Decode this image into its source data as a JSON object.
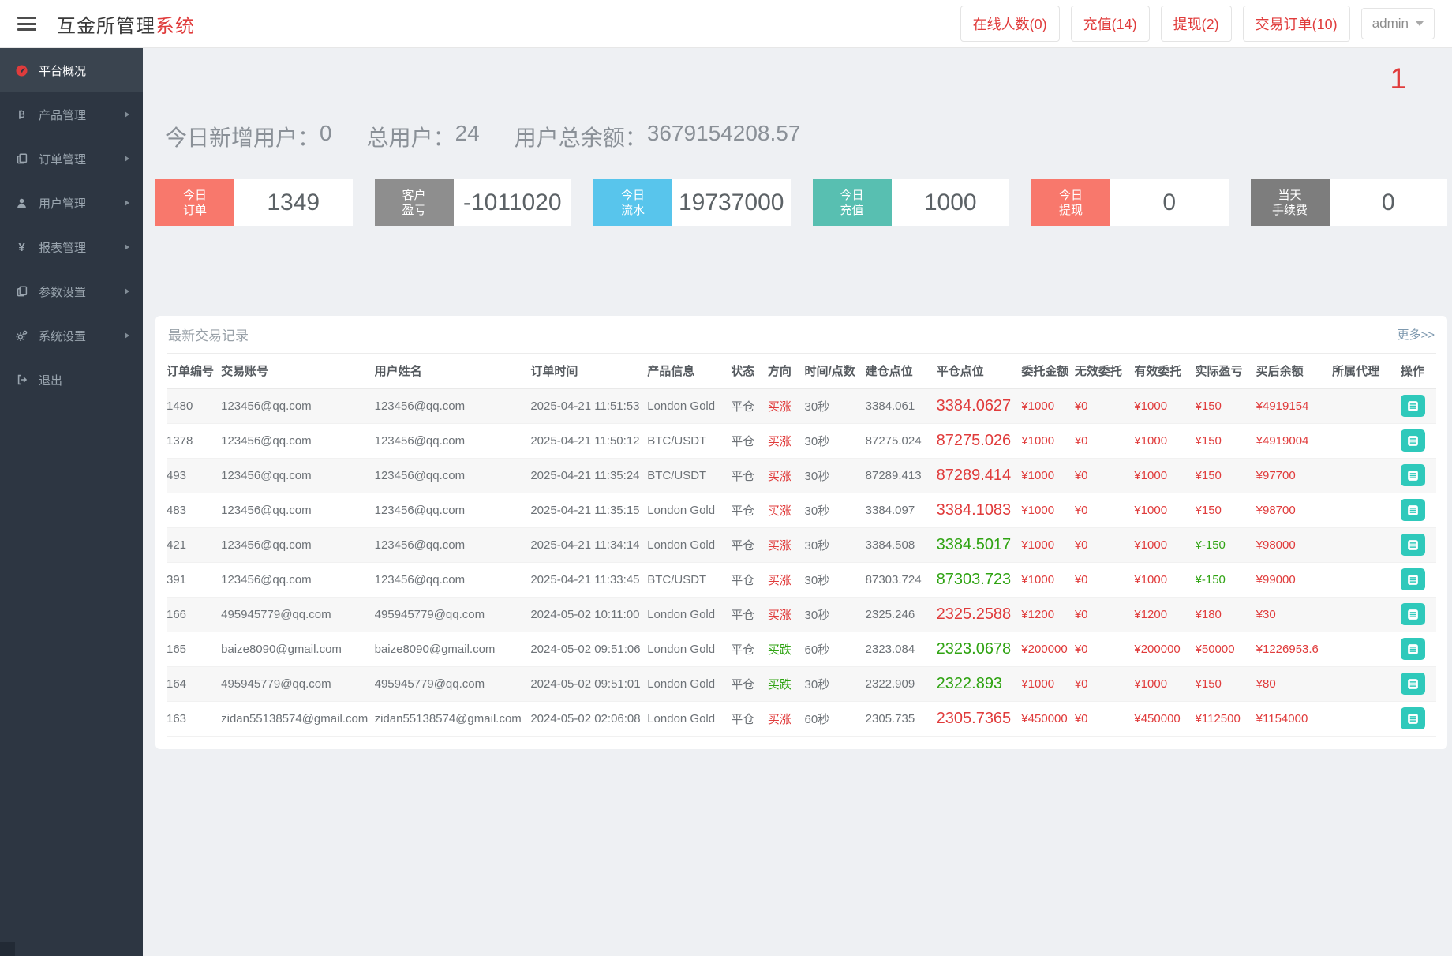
{
  "header": {
    "brand_dark": "互金所管理",
    "brand_red": "系统",
    "nav_buttons": [
      {
        "label": "在线人数(0)"
      },
      {
        "label": "充值(14)"
      },
      {
        "label": "提现(2)"
      },
      {
        "label": "交易订单(10)"
      }
    ],
    "user_label": "admin"
  },
  "sidebar": {
    "items": [
      {
        "label": "平台概况",
        "icon": "dashboard-icon",
        "active": true,
        "has_arrow": false
      },
      {
        "label": "产品管理",
        "icon": "bitcoin-icon",
        "active": false,
        "has_arrow": true
      },
      {
        "label": "订单管理",
        "icon": "orders-icon",
        "active": false,
        "has_arrow": true
      },
      {
        "label": "用户管理",
        "icon": "user-icon",
        "active": false,
        "has_arrow": true
      },
      {
        "label": "报表管理",
        "icon": "yen-icon",
        "active": false,
        "has_arrow": true
      },
      {
        "label": "参数设置",
        "icon": "params-icon",
        "active": false,
        "has_arrow": true
      },
      {
        "label": "系统设置",
        "icon": "gears-icon",
        "active": false,
        "has_arrow": true
      },
      {
        "label": "退出",
        "icon": "logout-icon",
        "active": false,
        "has_arrow": false
      }
    ]
  },
  "overview": {
    "corner_badge": "1",
    "stats": [
      {
        "label": "今日新增用户：",
        "value": "0"
      },
      {
        "label": "总用户：",
        "value": "24"
      },
      {
        "label": "用户总余额：",
        "value": "3679154208.57"
      }
    ],
    "cards": [
      {
        "line1": "今日",
        "line2": "订单",
        "value": "1349",
        "color": "#f8786c"
      },
      {
        "line1": "客户",
        "line2": "盈亏",
        "value": "-1011020",
        "color": "#8e8e8e"
      },
      {
        "line1": "今日",
        "line2": "流水",
        "value": "19737000",
        "color": "#58c5ec"
      },
      {
        "line1": "今日",
        "line2": "充值",
        "value": "1000",
        "color": "#58bfb1"
      },
      {
        "line1": "今日",
        "line2": "提现",
        "value": "0",
        "color": "#f8786c"
      },
      {
        "line1": "当天",
        "line2": "手续费",
        "value": "0",
        "color": "#7d7d7d"
      }
    ]
  },
  "panel": {
    "title": "最新交易记录",
    "more_label": "更多>>",
    "columns": [
      "订单编号",
      "交易账号",
      "用户姓名",
      "订单时间",
      "产品信息",
      "状态",
      "方向",
      "时间/点数",
      "建仓点位",
      "平仓点位",
      "委托金额",
      "无效委托",
      "有效委托",
      "实际盈亏",
      "买后余额",
      "所属代理",
      "操作"
    ],
    "rows": [
      {
        "id": "1480",
        "account": "123456@qq.com",
        "name": "123456@qq.com",
        "time": "2025-04-21 11:51:53",
        "product": "London Gold",
        "status": "平仓",
        "direction": "买涨",
        "direction_color": "up",
        "duration": "30秒",
        "open_point": "3384.061",
        "close_point": "3384.0627",
        "close_color": "up",
        "entrust": "¥1000",
        "invalid": "¥0",
        "valid": "¥1000",
        "profit": "¥150",
        "profit_color": "up",
        "balance": "¥4919154",
        "agent": ""
      },
      {
        "id": "1378",
        "account": "123456@qq.com",
        "name": "123456@qq.com",
        "time": "2025-04-21 11:50:12",
        "product": "BTC/USDT",
        "status": "平仓",
        "direction": "买涨",
        "direction_color": "up",
        "duration": "30秒",
        "open_point": "87275.024",
        "close_point": "87275.026",
        "close_color": "up",
        "entrust": "¥1000",
        "invalid": "¥0",
        "valid": "¥1000",
        "profit": "¥150",
        "profit_color": "up",
        "balance": "¥4919004",
        "agent": ""
      },
      {
        "id": "493",
        "account": "123456@qq.com",
        "name": "123456@qq.com",
        "time": "2025-04-21 11:35:24",
        "product": "BTC/USDT",
        "status": "平仓",
        "direction": "买涨",
        "direction_color": "up",
        "duration": "30秒",
        "open_point": "87289.413",
        "close_point": "87289.414",
        "close_color": "up",
        "entrust": "¥1000",
        "invalid": "¥0",
        "valid": "¥1000",
        "profit": "¥150",
        "profit_color": "up",
        "balance": "¥97700",
        "agent": ""
      },
      {
        "id": "483",
        "account": "123456@qq.com",
        "name": "123456@qq.com",
        "time": "2025-04-21 11:35:15",
        "product": "London Gold",
        "status": "平仓",
        "direction": "买涨",
        "direction_color": "up",
        "duration": "30秒",
        "open_point": "3384.097",
        "close_point": "3384.1083",
        "close_color": "up",
        "entrust": "¥1000",
        "invalid": "¥0",
        "valid": "¥1000",
        "profit": "¥150",
        "profit_color": "up",
        "balance": "¥98700",
        "agent": ""
      },
      {
        "id": "421",
        "account": "123456@qq.com",
        "name": "123456@qq.com",
        "time": "2025-04-21 11:34:14",
        "product": "London Gold",
        "status": "平仓",
        "direction": "买涨",
        "direction_color": "up",
        "duration": "30秒",
        "open_point": "3384.508",
        "close_point": "3384.5017",
        "close_color": "down",
        "entrust": "¥1000",
        "invalid": "¥0",
        "valid": "¥1000",
        "profit": "¥-150",
        "profit_color": "down",
        "balance": "¥98000",
        "agent": ""
      },
      {
        "id": "391",
        "account": "123456@qq.com",
        "name": "123456@qq.com",
        "time": "2025-04-21 11:33:45",
        "product": "BTC/USDT",
        "status": "平仓",
        "direction": "买涨",
        "direction_color": "up",
        "duration": "30秒",
        "open_point": "87303.724",
        "close_point": "87303.723",
        "close_color": "down",
        "entrust": "¥1000",
        "invalid": "¥0",
        "valid": "¥1000",
        "profit": "¥-150",
        "profit_color": "down",
        "balance": "¥99000",
        "agent": ""
      },
      {
        "id": "166",
        "account": "495945779@qq.com",
        "name": "495945779@qq.com",
        "time": "2024-05-02 10:11:00",
        "product": "London Gold",
        "status": "平仓",
        "direction": "买涨",
        "direction_color": "up",
        "duration": "30秒",
        "open_point": "2325.246",
        "close_point": "2325.2588",
        "close_color": "up",
        "entrust": "¥1200",
        "invalid": "¥0",
        "valid": "¥1200",
        "profit": "¥180",
        "profit_color": "up",
        "balance": "¥30",
        "agent": ""
      },
      {
        "id": "165",
        "account": "baize8090@gmail.com",
        "name": "baize8090@gmail.com",
        "time": "2024-05-02 09:51:06",
        "product": "London Gold",
        "status": "平仓",
        "direction": "买跌",
        "direction_color": "down",
        "duration": "60秒",
        "open_point": "2323.084",
        "close_point": "2323.0678",
        "close_color": "down",
        "entrust": "¥200000",
        "invalid": "¥0",
        "valid": "¥200000",
        "profit": "¥50000",
        "profit_color": "up",
        "balance": "¥1226953.6",
        "agent": ""
      },
      {
        "id": "164",
        "account": "495945779@qq.com",
        "name": "495945779@qq.com",
        "time": "2024-05-02 09:51:01",
        "product": "London Gold",
        "status": "平仓",
        "direction": "买跌",
        "direction_color": "down",
        "duration": "30秒",
        "open_point": "2322.909",
        "close_point": "2322.893",
        "close_color": "down",
        "entrust": "¥1000",
        "invalid": "¥0",
        "valid": "¥1000",
        "profit": "¥150",
        "profit_color": "up",
        "balance": "¥80",
        "agent": ""
      },
      {
        "id": "163",
        "account": "zidan55138574@gmail.com",
        "name": "zidan55138574@gmail.com",
        "time": "2024-05-02 02:06:08",
        "product": "London Gold",
        "status": "平仓",
        "direction": "买涨",
        "direction_color": "up",
        "duration": "60秒",
        "open_point": "2305.735",
        "close_point": "2305.7365",
        "close_color": "up",
        "entrust": "¥450000",
        "invalid": "¥0",
        "valid": "¥450000",
        "profit": "¥112500",
        "profit_color": "up",
        "balance": "¥1154000",
        "agent": ""
      }
    ]
  }
}
